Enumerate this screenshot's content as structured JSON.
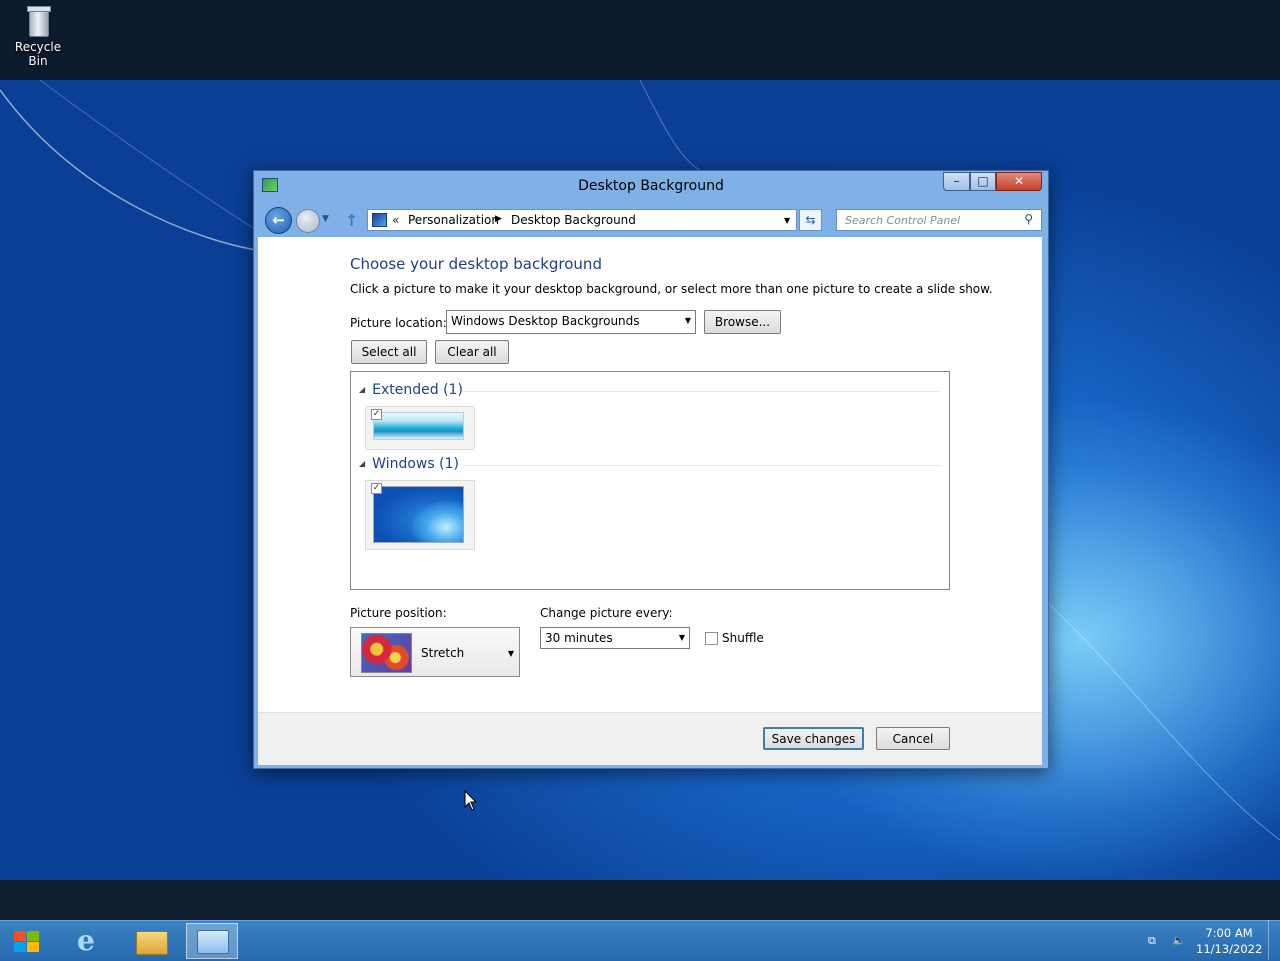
{
  "desktop": {
    "recycle_bin_label": "Recycle Bin"
  },
  "window": {
    "title": "Desktop Background",
    "controls": {
      "minimize": "–",
      "maximize": "□",
      "close": "✕"
    }
  },
  "navigation": {
    "back_glyph": "←",
    "up_glyph": "↑",
    "breadcrumb_overflow": "«",
    "breadcrumbs": [
      "Personalization",
      "Desktop Background"
    ],
    "separator_glyph": "▶",
    "dropdown_glyph": "▼",
    "refresh_glyph": "⇆",
    "search_placeholder": "Search Control Panel",
    "search_glyph": "⚲"
  },
  "content": {
    "heading": "Choose your desktop background",
    "description": "Click a picture to make it your desktop background, or select more than one picture to create a slide show.",
    "picture_location_label": "Picture location:",
    "picture_location_value": "Windows Desktop Backgrounds",
    "browse_label": "Browse...",
    "select_all_label": "Select all",
    "clear_all_label": "Clear all",
    "groups": [
      {
        "title": "Extended (1)",
        "items": [
          {
            "checked": true
          }
        ]
      },
      {
        "title": "Windows (1)",
        "items": [
          {
            "checked": true
          }
        ]
      }
    ],
    "collapse_glyph": "◢",
    "check_glyph": "✓",
    "picture_position_label": "Picture position:",
    "picture_position_value": "Stretch",
    "change_picture_label": "Change picture every:",
    "change_picture_value": "30 minutes",
    "shuffle_label": "Shuffle",
    "shuffle_checked": false
  },
  "footer": {
    "save_label": "Save changes",
    "cancel_label": "Cancel"
  },
  "taskbar": {
    "ie_glyph": "e",
    "tray": {
      "network_glyph": "⧉",
      "volume_glyph": "🔈"
    },
    "clock_time": "7:00 AM",
    "clock_date": "11/13/2022"
  },
  "colors": {
    "heading_blue": "#1e3e8f",
    "desktop_blue": "#1763c2",
    "taskbar_blue": "#2f75b8",
    "default_button_border": "#3c7fb1"
  }
}
